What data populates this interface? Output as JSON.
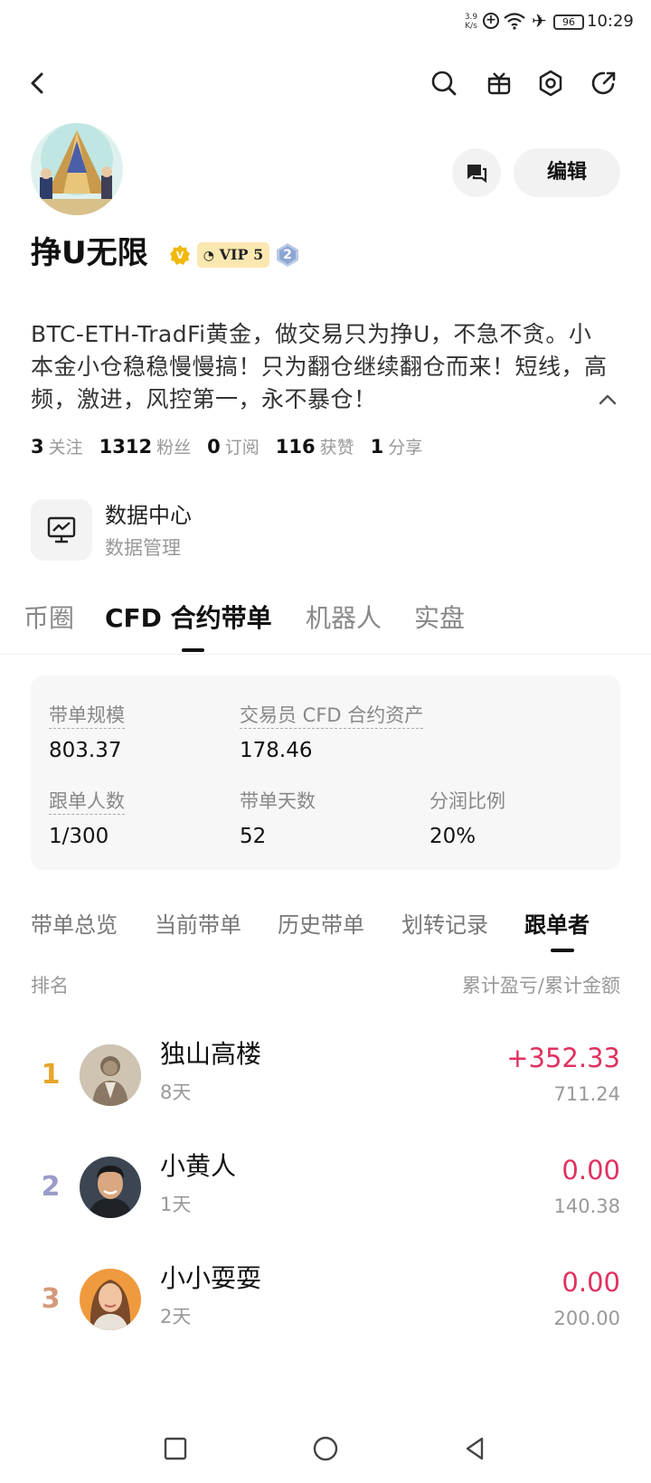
{
  "status_bar": {
    "speed": "3.9\nK/s",
    "battery": "96",
    "time": "10:29"
  },
  "profile": {
    "username": "挣U无限",
    "vip_label": "VIP 5",
    "level": "2",
    "edit_label": "编辑",
    "bio": "BTC-ETH-TradFi黄金，做交易只为挣U，不急不贪。小本金小仓稳稳慢慢搞！只为翻仓继续翻仓而来！短线，高频，激进，风控第一，永不暴仓！",
    "stats": [
      {
        "value": "3",
        "label": "关注"
      },
      {
        "value": "1312",
        "label": "粉丝"
      },
      {
        "value": "0",
        "label": "订阅"
      },
      {
        "value": "116",
        "label": "获赞"
      },
      {
        "value": "1",
        "label": "分享"
      }
    ]
  },
  "data_center": {
    "title": "数据中心",
    "subtitle": "数据管理"
  },
  "main_tabs": [
    {
      "label": "币圈"
    },
    {
      "label": "CFD 合约带单"
    },
    {
      "label": "机器人"
    },
    {
      "label": "实盘"
    }
  ],
  "card": {
    "scale_label": "带单规模",
    "scale_value": "803.37",
    "assets_label": "交易员 CFD 合约资产",
    "assets_value": "178.46",
    "followers_label": "跟单人数",
    "followers_value": "1/300",
    "days_label": "带单天数",
    "days_value": "52",
    "share_label": "分润比例",
    "share_value": "20%"
  },
  "sub_tabs": [
    {
      "label": "带单总览"
    },
    {
      "label": "当前带单"
    },
    {
      "label": "历史带单"
    },
    {
      "label": "划转记录"
    },
    {
      "label": "跟单者"
    }
  ],
  "list": {
    "header_left": "排名",
    "header_right": "累计盈亏/累计金额",
    "rows": [
      {
        "rank": "1",
        "name": "独山高楼",
        "days": "8天",
        "pnl": "+352.33",
        "amount": "711.24",
        "rank_color": "#e5a62b"
      },
      {
        "rank": "2",
        "name": "小黄人",
        "days": "1天",
        "pnl": "0.00",
        "amount": "140.38",
        "rank_color": "#9b9bc9"
      },
      {
        "rank": "3",
        "name": "小小耍耍",
        "days": "2天",
        "pnl": "0.00",
        "amount": "200.00",
        "rank_color": "#d49a7d"
      }
    ]
  },
  "colors": {
    "accent_red": "#e0315f",
    "vip_bg": "#fbe7b0",
    "verified": "#f0b90b"
  }
}
